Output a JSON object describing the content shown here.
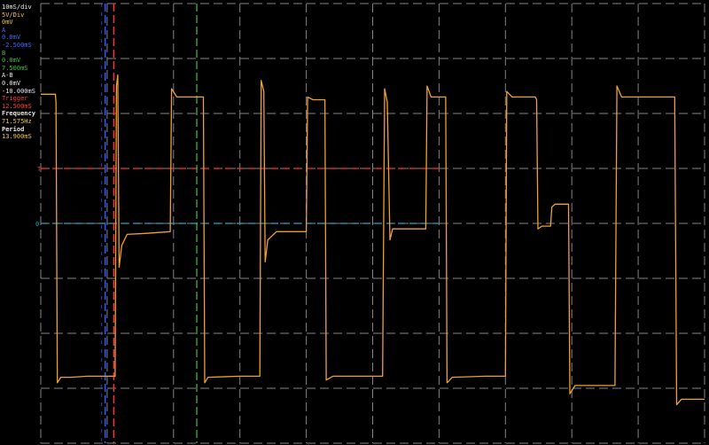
{
  "readout": {
    "timebase": "10mS/div",
    "volts_per_div": "5V/Div",
    "offset": "0mV",
    "cursor_a_label": "A",
    "cursor_a_volt": "0.0mV",
    "cursor_a_time": "-2.500mS",
    "cursor_b_label": "B",
    "cursor_b_volt": "0.0mV",
    "cursor_b_time": "7.500mS",
    "delta_label": "A-B",
    "delta_volt": "0.0mV",
    "delta_time": "-10.000mS",
    "trigger_label": "Trigger",
    "trigger_time": "12.500mS",
    "frequency_label": "Frequency",
    "frequency_value": "71.575Hz",
    "period_label": "Period",
    "period_value": "13.900mS"
  },
  "markers": {
    "trigger_level": "T",
    "zero_level": "0"
  },
  "colors": {
    "background": "#000000",
    "grid": "#9a9a9a",
    "trace": "#f0a030",
    "cursor_a": "#2f5bff",
    "cursor_b": "#3fbf3f",
    "trigger": "#ff3030",
    "zero_line": "#2aa6c8"
  },
  "chart_data": {
    "type": "line",
    "grid": true,
    "xlim_div": [
      0,
      10
    ],
    "ylim_div": [
      -4,
      4
    ],
    "timebase": "10mS/div",
    "volts_per_div": "5V/Div",
    "trigger_level_div": 1.0,
    "zero_level_div": 0,
    "cursor_a_div": 0.97,
    "cursor_b_div": 2.35,
    "trigger_cursor_div": 1.1,
    "series": [
      {
        "points": [
          [
            0.0,
            2.35
          ],
          [
            0.22,
            2.35
          ],
          [
            0.23,
            2.2
          ],
          [
            0.25,
            -2.9
          ],
          [
            0.3,
            -2.8
          ],
          [
            0.45,
            -2.8
          ],
          [
            0.7,
            -2.78
          ],
          [
            0.95,
            -2.78
          ],
          [
            1.05,
            -2.78
          ],
          [
            1.12,
            -2.78
          ],
          [
            1.14,
            2.5
          ],
          [
            1.16,
            2.7
          ],
          [
            1.18,
            -0.8
          ],
          [
            1.22,
            -0.4
          ],
          [
            1.3,
            -0.2
          ],
          [
            1.6,
            -0.18
          ],
          [
            1.95,
            -0.15
          ],
          [
            1.97,
            2.45
          ],
          [
            2.05,
            2.3
          ],
          [
            2.3,
            2.3
          ],
          [
            2.45,
            2.3
          ],
          [
            2.47,
            -2.9
          ],
          [
            2.52,
            -2.8
          ],
          [
            3.0,
            -2.78
          ],
          [
            3.3,
            -2.78
          ],
          [
            3.32,
            2.6
          ],
          [
            3.36,
            2.4
          ],
          [
            3.38,
            -0.7
          ],
          [
            3.42,
            -0.3
          ],
          [
            3.55,
            -0.15
          ],
          [
            4.0,
            -0.15
          ],
          [
            4.02,
            2.3
          ],
          [
            4.1,
            2.25
          ],
          [
            4.28,
            2.25
          ],
          [
            4.3,
            -2.85
          ],
          [
            4.4,
            -2.78
          ],
          [
            5.0,
            -2.78
          ],
          [
            5.15,
            -2.78
          ],
          [
            5.18,
            2.45
          ],
          [
            5.22,
            2.2
          ],
          [
            5.26,
            -0.3
          ],
          [
            5.3,
            -0.1
          ],
          [
            5.5,
            -0.1
          ],
          [
            5.8,
            -0.1
          ],
          [
            5.82,
            2.5
          ],
          [
            5.88,
            2.3
          ],
          [
            6.1,
            2.3
          ],
          [
            6.12,
            -2.9
          ],
          [
            6.2,
            -2.8
          ],
          [
            6.7,
            -2.78
          ],
          [
            7.0,
            -2.78
          ],
          [
            7.02,
            2.4
          ],
          [
            7.1,
            2.3
          ],
          [
            7.45,
            2.3
          ],
          [
            7.47,
            2.25
          ],
          [
            7.49,
            -0.1
          ],
          [
            7.55,
            -0.05
          ],
          [
            7.68,
            -0.05
          ],
          [
            7.7,
            0.3
          ],
          [
            7.75,
            0.35
          ],
          [
            7.95,
            0.35
          ],
          [
            7.97,
            -3.1
          ],
          [
            8.05,
            -2.95
          ],
          [
            8.6,
            -2.95
          ],
          [
            8.65,
            -2.95
          ],
          [
            8.68,
            2.5
          ],
          [
            8.75,
            2.3
          ],
          [
            9.3,
            2.3
          ],
          [
            9.55,
            2.3
          ],
          [
            9.58,
            -3.3
          ],
          [
            9.65,
            -3.2
          ],
          [
            10.0,
            -3.2
          ]
        ]
      }
    ]
  }
}
